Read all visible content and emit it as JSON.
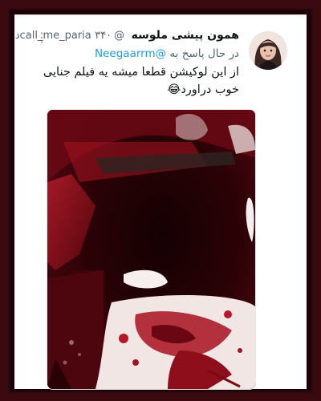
{
  "tweet": {
    "display_name": "همون پیشی ملوسه",
    "handle": "@call_me_paria",
    "time": "۳۴۰د",
    "reply_prefix": "در حال پاسخ به",
    "reply_to": "@Neegaarrm",
    "text": "از این لوکیشن قطعا میشه یه فیلم جنایی خوب دراورد😂"
  },
  "icons": {
    "more": "more-vertical-icon"
  }
}
